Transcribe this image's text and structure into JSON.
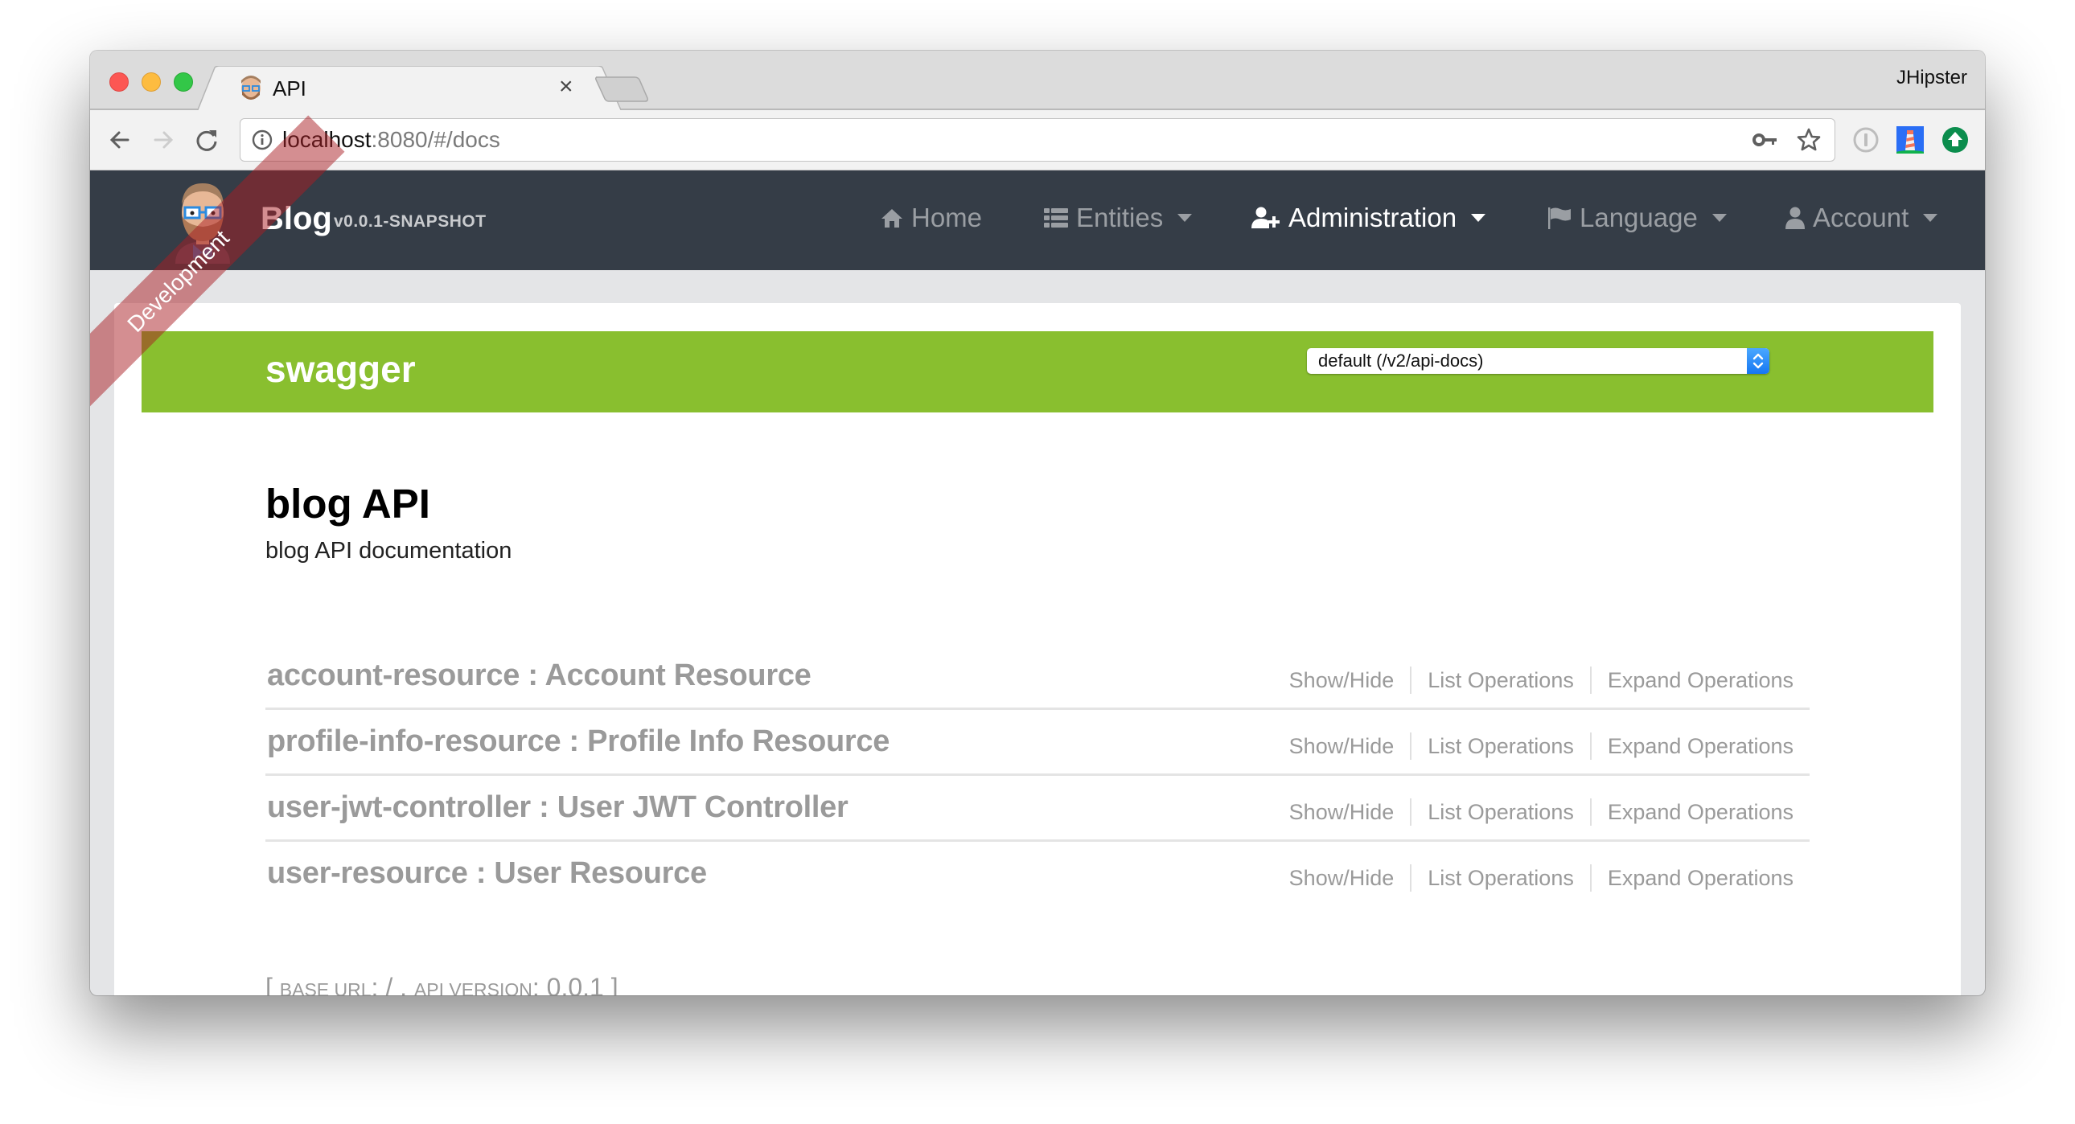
{
  "browser": {
    "tab_title": "API",
    "tab_favicon": "jhipster-avatar-icon",
    "profile_name": "JHipster",
    "url_host": "localhost",
    "url_rest": ":8080/#/docs",
    "extensions": [
      "1password-icon",
      "lighthouse-icon",
      "update-arrow-icon"
    ]
  },
  "navbar": {
    "brand": "Blog",
    "version": "v0.0.1-SNAPSHOT",
    "ribbon": "Development",
    "items": [
      {
        "label": "Home",
        "icon": "home-icon",
        "dropdown": false
      },
      {
        "label": "Entities",
        "icon": "list-icon",
        "dropdown": true
      },
      {
        "label": "Administration",
        "icon": "user-plus-icon",
        "dropdown": true,
        "active": true
      },
      {
        "label": "Language",
        "icon": "flag-icon",
        "dropdown": true
      },
      {
        "label": "Account",
        "icon": "user-icon",
        "dropdown": true
      }
    ]
  },
  "swagger": {
    "logo": "swagger",
    "spec_selected": "default (/v2/api-docs)"
  },
  "api": {
    "title": "blog API",
    "description": "blog API documentation"
  },
  "resources": [
    {
      "name": "account-resource : Account Resource"
    },
    {
      "name": "profile-info-resource : Profile Info Resource"
    },
    {
      "name": "user-jwt-controller : User JWT Controller"
    },
    {
      "name": "user-resource : User Resource"
    }
  ],
  "resource_ops": {
    "show_hide": "Show/Hide",
    "list": "List Operations",
    "expand": "Expand Operations"
  },
  "footer": {
    "open": "[ ",
    "base_url_label": "Base URL",
    "base_url_value": ": / , ",
    "api_version_label": "API Version",
    "api_version_value": ": 0.0.1 ",
    "close": "]"
  },
  "colors": {
    "navbar": "#353d47",
    "swagger_green": "#89bf2f",
    "resource_text": "#9a9a9a"
  }
}
